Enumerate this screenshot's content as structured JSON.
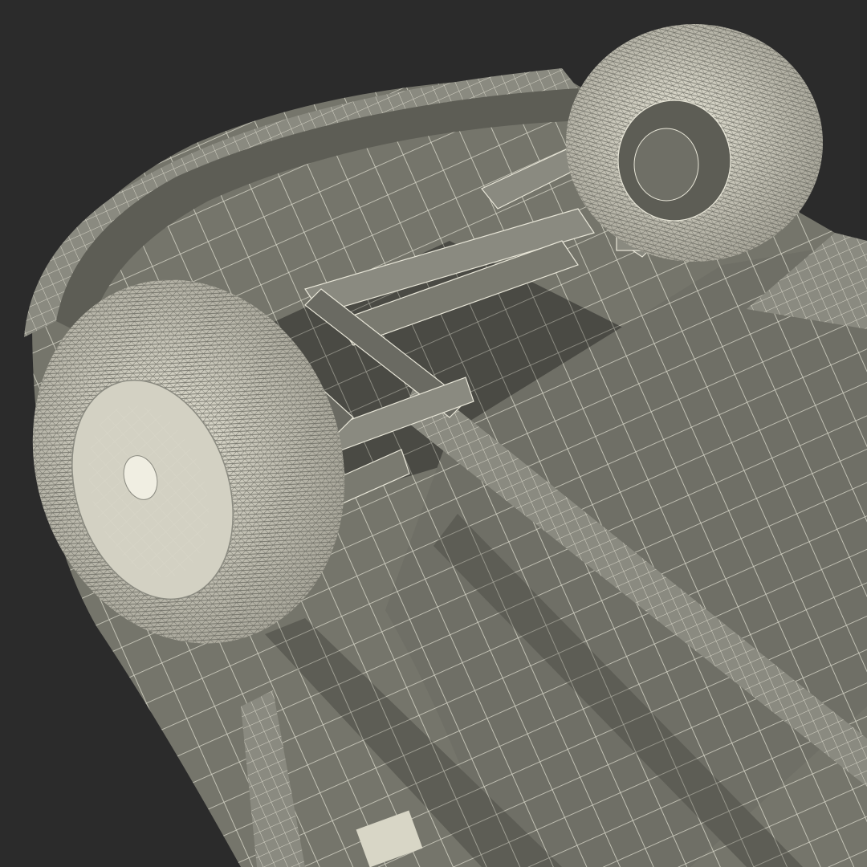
{
  "scene": {
    "subject": "car-underbody-wireframe-render",
    "colors": {
      "background": "#2b2b2b",
      "surface": "#75756b",
      "surface_dark": "#5d5d55",
      "surface_light": "#8a8a80",
      "wire": "#e8e6d8",
      "tire": "#d8d6c6",
      "shadow": "#3c3c37"
    }
  }
}
